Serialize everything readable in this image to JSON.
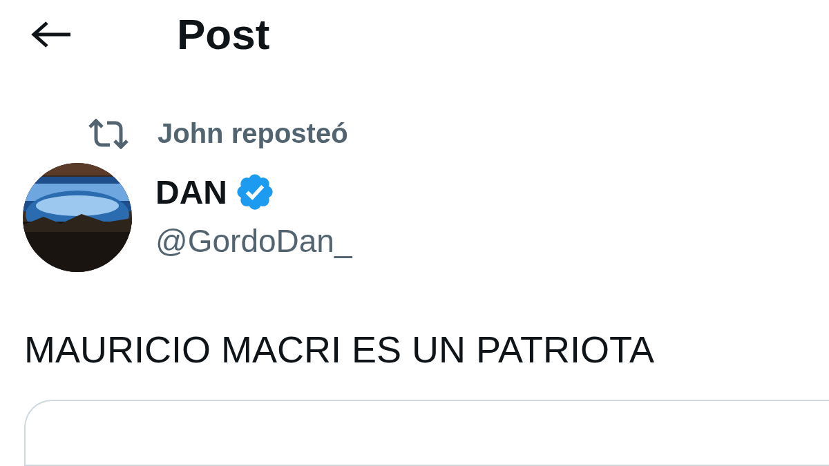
{
  "header": {
    "title": "Post"
  },
  "repost": {
    "label": "John reposteó"
  },
  "author": {
    "name": "DAN",
    "verified": true,
    "handle": "@GordoDan_"
  },
  "post": {
    "text": "MAURICIO MACRI ES UN PATRIOTA"
  }
}
